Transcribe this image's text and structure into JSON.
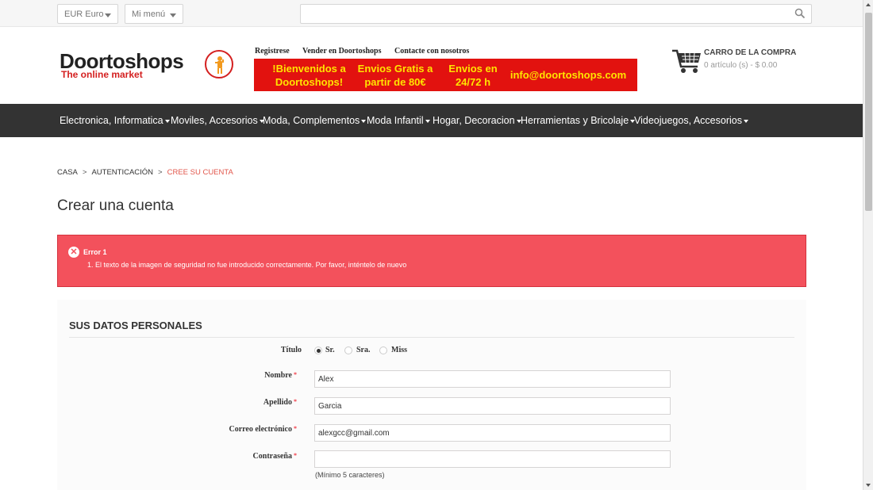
{
  "topbar": {
    "currency": "EUR Euro",
    "my_menu": "Mi menú",
    "search_placeholder": ""
  },
  "logo": {
    "main": "Doortoshops",
    "sub": "The online market"
  },
  "toplinks": [
    "Registrese",
    "Vender en Doortoshops",
    "Contacte con nosotros"
  ],
  "banner": {
    "welcome": "!Bienvenidos a Doortoshops!",
    "shipping_free": "Envios Gratis a partir de 80€",
    "shipping_time": "Envios en 24/72 h",
    "email": "info@doortoshops.com"
  },
  "cart": {
    "title": "CARRO DE LA COMPRA",
    "summary": "0 artículo (s) - $ 0.00"
  },
  "nav": {
    "items": [
      "Electronica, Informatica",
      "Moviles, Accesorios",
      "Moda, Complementos",
      "Moda Infantil",
      "Hogar, Decoracion",
      "Herramientas y Bricolaje",
      "Videojuegos, Accesorios"
    ]
  },
  "breadcrumb": {
    "home": "CASA",
    "sep": ">",
    "auth": "AUTENTICACIÓN",
    "current": "CREE SU CUENTA"
  },
  "page_title": "Crear una cuenta",
  "error": {
    "title": "Error 1",
    "message": "1. El texto de la imagen de seguridad no fue introducido correctamente. Por favor, inténtelo de nuevo"
  },
  "form": {
    "heading": "SUS DATOS PERSONALES",
    "title_label": "Título",
    "title_options": [
      "Sr.",
      "Sra.",
      "Miss"
    ],
    "selected_title": "Sr.",
    "first_name_label": "Nombre",
    "first_name_value": "Alex",
    "last_name_label": "Apellido",
    "last_name_value": "Garcia",
    "email_label": "Correo electrónico",
    "email_value": "alexgcc@gmail.com",
    "password_label": "Contraseña",
    "password_value": "",
    "password_hint": "(Mínimo 5 caracteres)",
    "required_mark": "*"
  },
  "colors": {
    "accent_red": "#e2120f",
    "banner_text": "#ffe400",
    "nav_bg": "#333333",
    "error_bg": "#f3515c",
    "breadcrumb_current": "#e2574c"
  }
}
